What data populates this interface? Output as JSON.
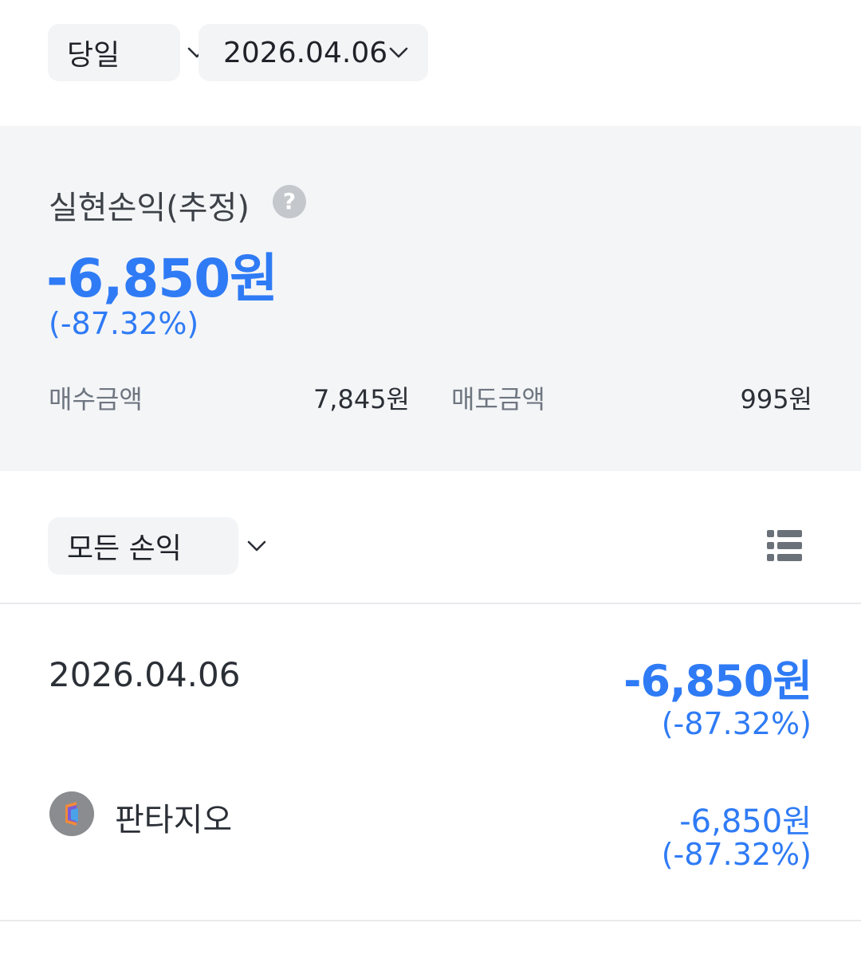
{
  "filters": {
    "period": "당일",
    "date": "2026.04.06"
  },
  "summary": {
    "title": "실현손익(추정)",
    "help_icon": "question-icon",
    "amount": "-6,850원",
    "rate": "(-87.32%)",
    "buy_label": "매수금액",
    "buy_value": "7,845원",
    "sell_label": "매도금액",
    "sell_value": "995원"
  },
  "list_controls": {
    "filter": "모든 손익",
    "view_icon": "list-icon"
  },
  "daily": [
    {
      "date": "2026.04.06",
      "amount": "-6,850원",
      "rate": "(-87.32%)",
      "items": [
        {
          "name": "판타지오",
          "amount": "-6,850원",
          "rate": "(-87.32%)"
        }
      ]
    }
  ],
  "colors": {
    "loss": "#2f7bf5",
    "chip_bg": "#f3f4f6",
    "summary_bg": "#f4f5f7"
  }
}
